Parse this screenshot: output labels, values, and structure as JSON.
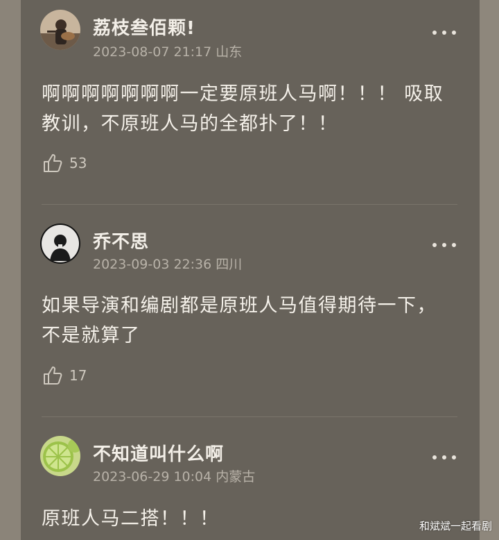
{
  "comments": [
    {
      "username": "荔枝叁佰颗!",
      "meta": "2023-08-07 21:17 山东",
      "body": "啊啊啊啊啊啊啊一定要原班人马啊！！！ 吸取\n教训，不原班人马的全都扑了！！",
      "likes": "53",
      "avatar_icon": "avatar-photo-guitar"
    },
    {
      "username": "乔不思",
      "meta": "2023-09-03 22:36 四川",
      "body": "如果导演和编剧都是原班人马值得期待一下，\n不是就算了",
      "likes": "17",
      "avatar_icon": "avatar-photo-portrait"
    },
    {
      "username": "不知道叫什么啊",
      "meta": "2023-06-29 10:04 内蒙古",
      "body": "原班人马二搭！！！",
      "likes": "",
      "avatar_icon": "avatar-photo-lime"
    }
  ],
  "icons": {
    "like": "thumbs-up-icon",
    "more": "more-dots-icon"
  },
  "watermark": "和斌斌一起看剧"
}
